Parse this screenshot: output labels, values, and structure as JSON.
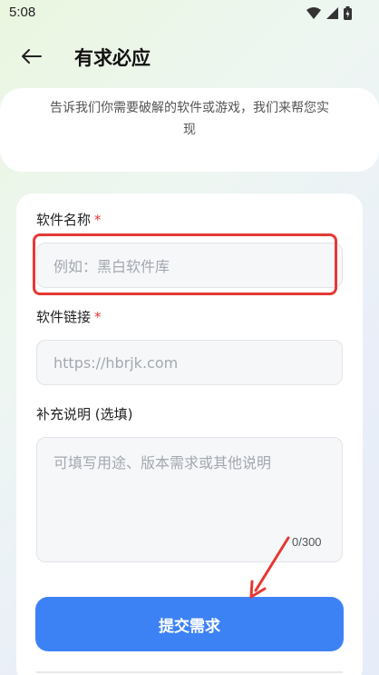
{
  "status_bar": {
    "time": "5:08"
  },
  "header": {
    "title": "有求必应"
  },
  "intro": {
    "text": "告诉我们你需要破解的软件或游戏，我们来帮您实现"
  },
  "form": {
    "software_name": {
      "label": "软件名称",
      "required_mark": "*",
      "placeholder": "例如：黑白软件库",
      "value": ""
    },
    "software_link": {
      "label": "软件链接",
      "required_mark": "*",
      "placeholder": "https://hbrjk.com",
      "value": ""
    },
    "notes": {
      "label": "补充说明 (选填)",
      "placeholder": "可填写用途、版本需求或其他说明",
      "value": "",
      "counter": "0/300"
    },
    "submit_label": "提交需求"
  },
  "colors": {
    "accent": "#3d82f5",
    "required": "#e53935",
    "annotation": "#e53935"
  }
}
